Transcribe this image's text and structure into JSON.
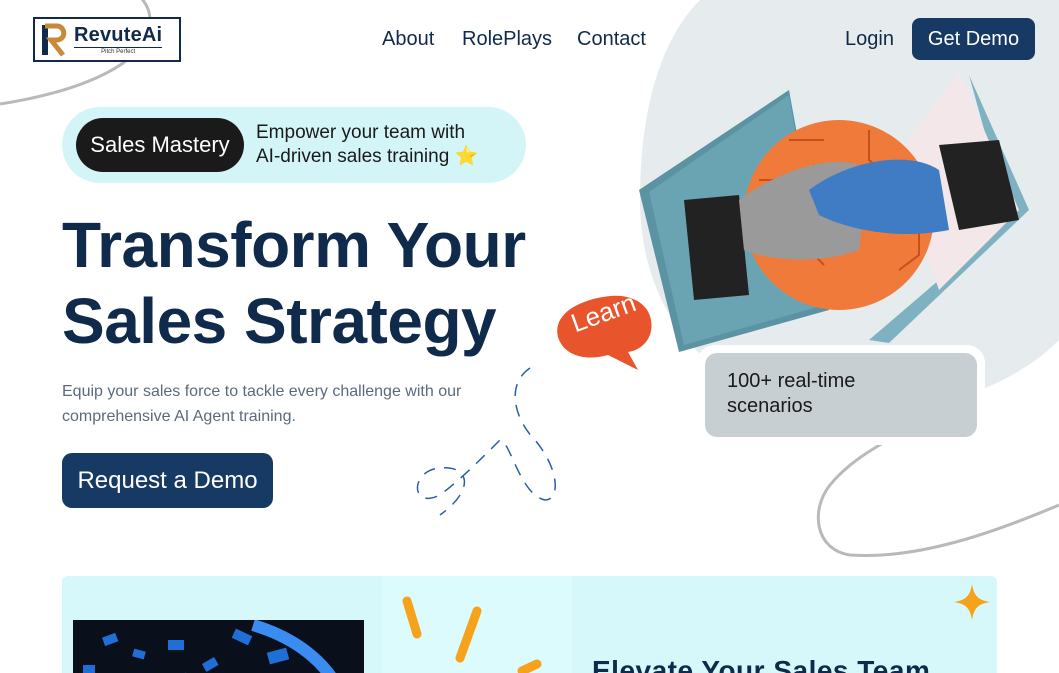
{
  "brand": {
    "name": "RevuteAi",
    "tagline": "Pitch Perfect",
    "primary_color": "#173a64",
    "accent_color": "#e8542b"
  },
  "nav": {
    "links": [
      {
        "label": "About"
      },
      {
        "label": "RolePlays"
      },
      {
        "label": "Contact"
      }
    ],
    "login_label": "Login",
    "get_demo_label": "Get Demo"
  },
  "badge": {
    "tag": "Sales Mastery",
    "line1": "Empower your team with",
    "line2": "AI-driven sales training ⭐"
  },
  "hero": {
    "title_line1": "Transform Your",
    "title_line2": "Sales Strategy",
    "subtitle_line1": "Equip your sales force to tackle every challenge with our",
    "subtitle_line2": "comprehensive AI Agent training.",
    "cta_label": "Request a Demo"
  },
  "graphic": {
    "bubble_label": "Learn",
    "scenario_line1": "100+ real-time",
    "scenario_line2": "scenarios",
    "image_subject": "human-robot-handshake"
  },
  "lower_section": {
    "heading": "Elevate Your Sales Team"
  }
}
